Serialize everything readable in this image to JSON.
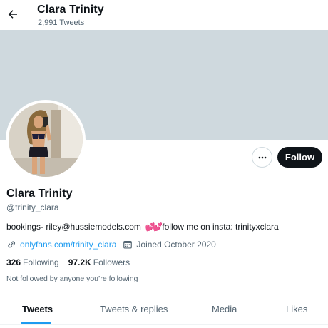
{
  "header": {
    "name": "Clara Trinity",
    "tweet_count": "2,991 Tweets"
  },
  "profile": {
    "display_name": "Clara Trinity",
    "handle": "@trinity_clara",
    "bio_before": "bookings- riley@hussiemodels.com ",
    "bio_emoji": "💕💕",
    "bio_after": "follow me on insta: trinityxclara",
    "website": "onlyfans.com/trinity_clara",
    "joined": "Joined October 2020"
  },
  "actions": {
    "follow_label": "Follow"
  },
  "stats": {
    "following_count": "326",
    "following_label": "Following",
    "followers_count": "97.2K",
    "followers_label": "Followers"
  },
  "followed_note": "Not followed by anyone you’re following",
  "tabs": [
    {
      "label": "Tweets",
      "active": true
    },
    {
      "label": "Tweets & replies",
      "active": false
    },
    {
      "label": "Media",
      "active": false
    },
    {
      "label": "Likes",
      "active": false
    }
  ],
  "colors": {
    "accent": "#1d9bf0",
    "banner": "#cfd9de",
    "text_primary": "#0f1419",
    "text_secondary": "#536471"
  },
  "icons": {
    "back": "arrow-left-icon",
    "more": "more-horizontal-icon",
    "link": "link-icon",
    "calendar": "calendar-icon",
    "emoji": "two-hearts-icon"
  }
}
